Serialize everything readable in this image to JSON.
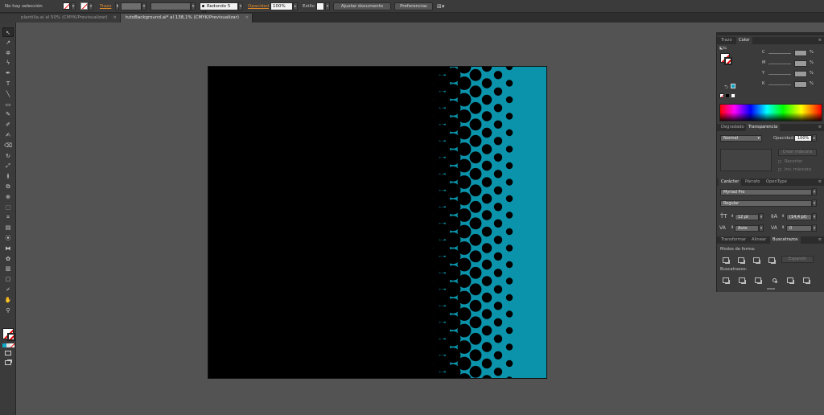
{
  "control_bar": {
    "selection_status": "No hay selección",
    "stroke_label": "Trazo",
    "stroke_profile_value": "Redondo 5 pt.",
    "opacity_label": "Opacidad",
    "opacity_value": "100%",
    "style_label": "Estilo",
    "adjust_document_button": "Ajustar documento",
    "preferences_button": "Preferencias"
  },
  "tabs": [
    {
      "label": "plantilla.ai al 50% (CMYK/Previsualizar)",
      "close": "×"
    },
    {
      "label": "tutoBackground.ai* al 138,1% (CMYK/Previsualizar)",
      "close": "×"
    }
  ],
  "tools": [
    "selection-tool",
    "direct-selection-tool",
    "magic-wand-tool",
    "lasso-tool",
    "pen-tool",
    "type-tool",
    "line-segment-tool",
    "rectangle-tool",
    "paintbrush-tool",
    "pencil-tool",
    "blob-brush-tool",
    "eraser-tool",
    "rotate-tool",
    "scale-tool",
    "width-tool",
    "free-transform-tool",
    "shape-builder-tool",
    "perspective-grid-tool",
    "mesh-tool",
    "gradient-tool",
    "eyedropper-tool",
    "blend-tool",
    "symbol-sprayer-tool",
    "column-graph-tool",
    "artboard-tool",
    "slice-tool",
    "hand-tool",
    "zoom-tool"
  ],
  "color_panel": {
    "tabs": [
      "Trazo",
      "Color"
    ],
    "channels": [
      {
        "label": "C",
        "unit": "%"
      },
      {
        "label": "M",
        "unit": "%"
      },
      {
        "label": "Y",
        "unit": "%"
      },
      {
        "label": "K",
        "unit": "%"
      }
    ]
  },
  "transparency_panel": {
    "tabs": [
      "Degradado",
      "Transparencia"
    ],
    "blend_mode": "Normal",
    "opacity_label": "Opacidad:",
    "opacity_value": "100%",
    "make_mask_button": "Crear máscara",
    "clip_label": "Recortar",
    "invert_mask_label": "Inv. máscara"
  },
  "character_panel": {
    "tabs": [
      "Carácter",
      "Párrafo",
      "OpenType"
    ],
    "font_family": "Myriad Pro",
    "font_style": "Regular",
    "font_size": "12 pt",
    "leading": "(14,4 pt)",
    "kerning": "Auto",
    "tracking": "0"
  },
  "pathfinder_panel": {
    "tabs": [
      "Transformar",
      "Alinear",
      "Buscatrazos"
    ],
    "shape_modes_label": "Modos de forma:",
    "expand_button": "Expandir",
    "pathfinders_label": "Buscatrazos:"
  },
  "colors": {
    "artwork_cyan": "#0a93aa",
    "artwork_black": "#000000",
    "accent_orange": "#e08a2a"
  }
}
